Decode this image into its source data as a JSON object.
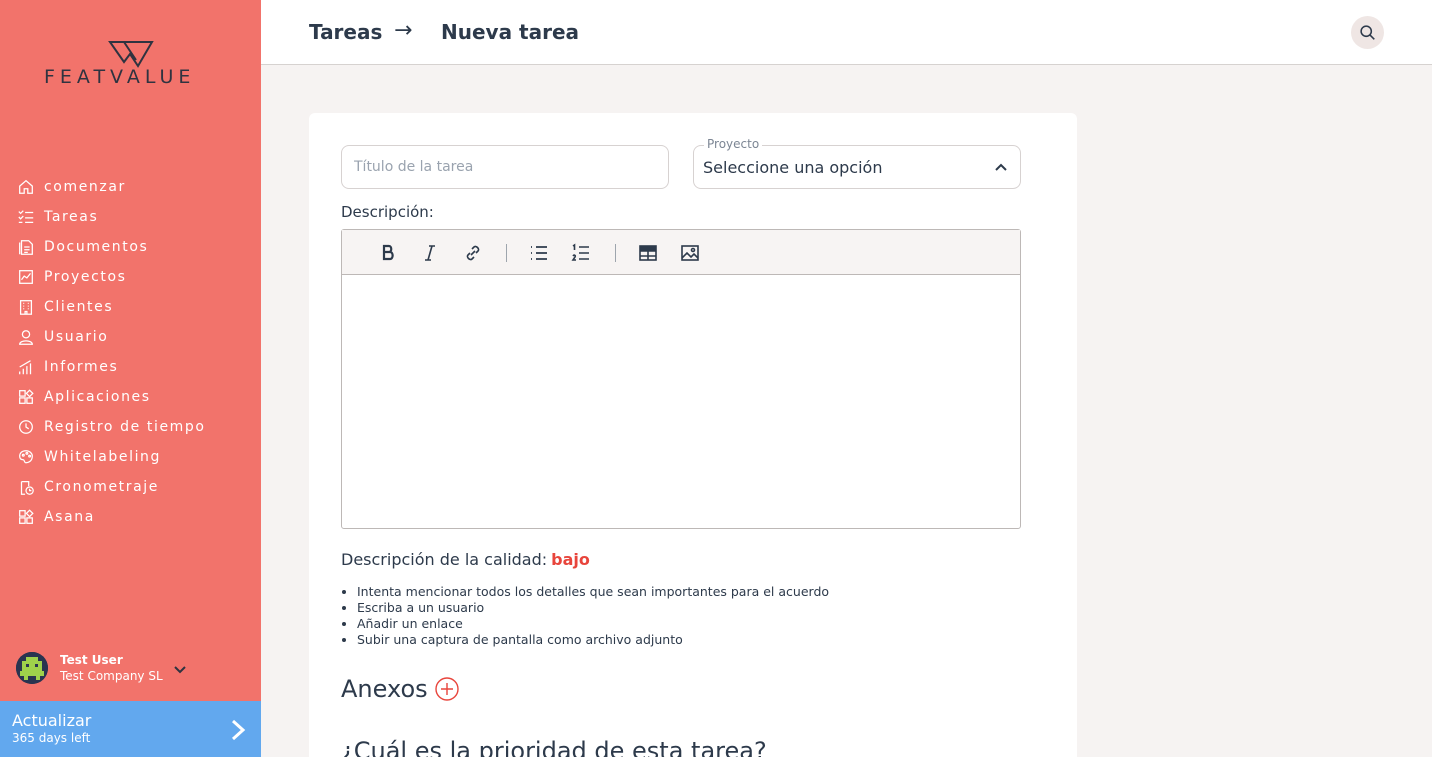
{
  "brand": {
    "name": "FEATVALUE"
  },
  "sidebar": {
    "items": [
      {
        "label": "comenzar",
        "icon": "home-icon"
      },
      {
        "label": "Tareas",
        "icon": "tasks-icon"
      },
      {
        "label": "Documentos",
        "icon": "documents-icon"
      },
      {
        "label": "Proyectos",
        "icon": "projects-icon"
      },
      {
        "label": "Clientes",
        "icon": "clients-icon"
      },
      {
        "label": "Usuario",
        "icon": "user-icon"
      },
      {
        "label": "Informes",
        "icon": "reports-icon"
      },
      {
        "label": "Aplicaciones",
        "icon": "apps-icon"
      },
      {
        "label": "Registro de tiempo",
        "icon": "time-log-icon"
      },
      {
        "label": "Whitelabeling",
        "icon": "whitelabel-icon"
      },
      {
        "label": "Cronometraje",
        "icon": "stopwatch-icon"
      },
      {
        "label": "Asana",
        "icon": "asana-icon"
      }
    ],
    "user": {
      "name": "Test User",
      "company": "Test Company SL"
    },
    "upgrade": {
      "title": "Actualizar",
      "subtitle": "365 days left"
    }
  },
  "header": {
    "breadcrumb_parent": "Tareas",
    "breadcrumb_arrow": "→",
    "breadcrumb_current": "Nueva tarea"
  },
  "form": {
    "title_placeholder": "Título de la tarea",
    "title_value": "",
    "project_legend": "Proyecto",
    "project_value": "Seleccione una opción",
    "description_label": "Descripción:",
    "quality_label": "Descripción de la calidad:",
    "quality_value": "bajo",
    "tips": [
      "Intenta mencionar todos los detalles que sean importantes para el acuerdo",
      "Escriba a un usuario",
      "Añadir un enlace",
      "Subir una captura de pantalla como archivo adjunto"
    ],
    "annex_title": "Anexos",
    "priority_title": "¿Cuál es la prioridad de esta tarea?"
  },
  "colors": {
    "sidebar_bg": "#f2736b",
    "upgrade_bg": "#62a8ee",
    "accent_red": "#e8453c",
    "text_dark": "#2d3a4b"
  }
}
